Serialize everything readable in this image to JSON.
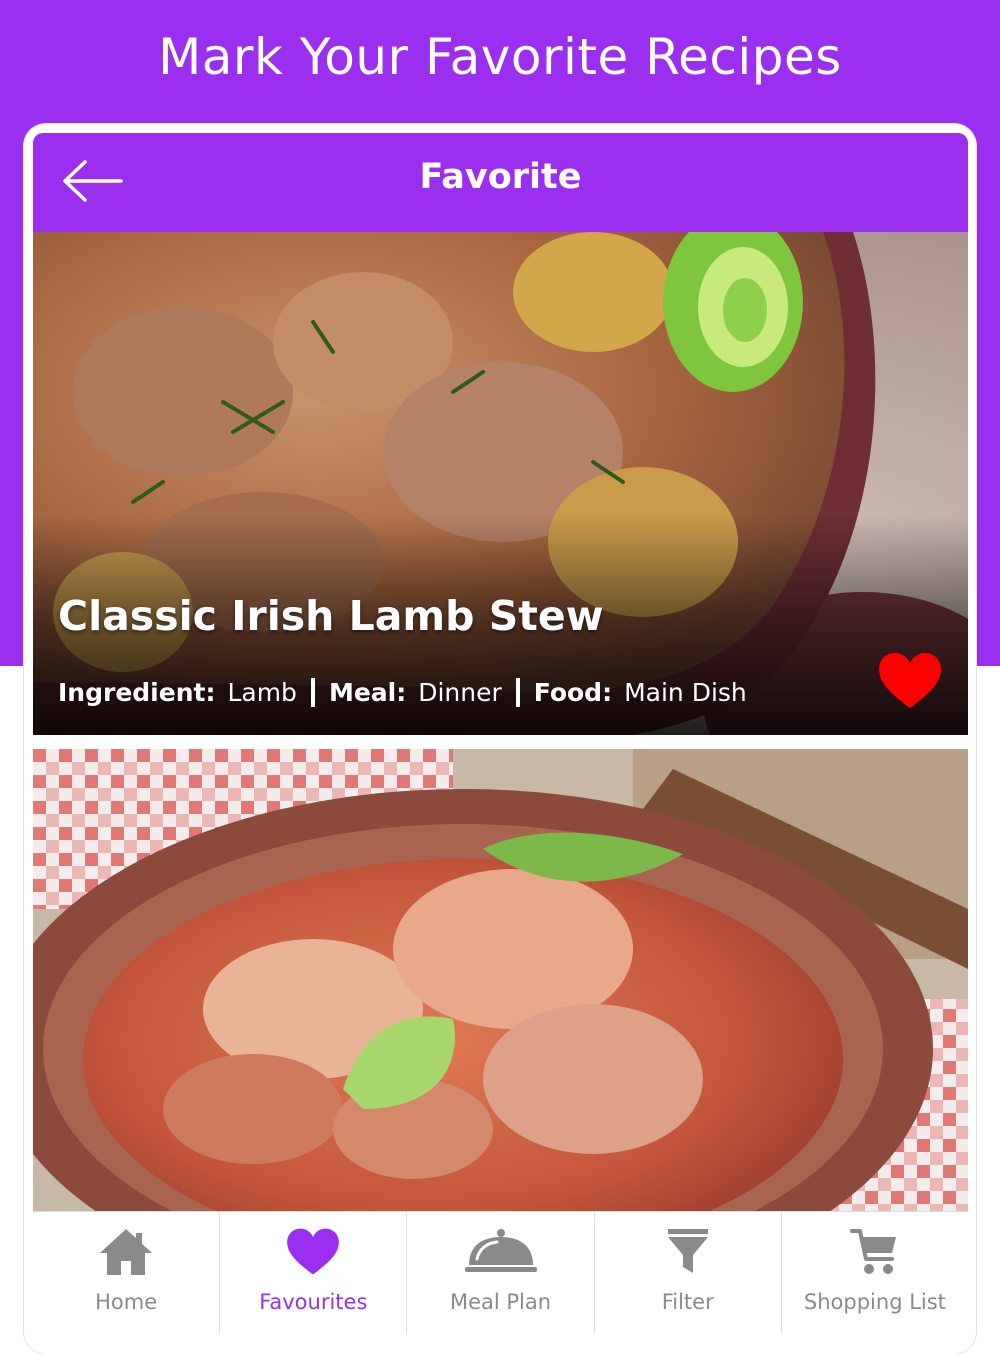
{
  "promo": {
    "title": "Mark Your Favorite Recipes"
  },
  "header": {
    "title": "Favorite"
  },
  "recipes": [
    {
      "title": "Classic Irish Lamb Stew",
      "ingredient_key": "Ingredient:",
      "ingredient_value": "Lamb",
      "meal_key": "Meal:",
      "meal_value": "Dinner",
      "food_key": "Food:",
      "food_value": "Main Dish",
      "favorite": true
    },
    {
      "title": "",
      "favorite": true
    }
  ],
  "tabs": [
    {
      "label": "Home",
      "icon": "home-icon",
      "active": false
    },
    {
      "label": "Favourites",
      "icon": "heart-icon",
      "active": true
    },
    {
      "label": "Meal Plan",
      "icon": "cloche-icon",
      "active": false
    },
    {
      "label": "Filter",
      "icon": "filter-icon",
      "active": false
    },
    {
      "label": "Shopping List",
      "icon": "cart-icon",
      "active": false
    }
  ],
  "colors": {
    "brand_purple": "#9a2ff0",
    "favorite_red": "#ff0000",
    "tab_inactive": "#8a8a8a"
  }
}
